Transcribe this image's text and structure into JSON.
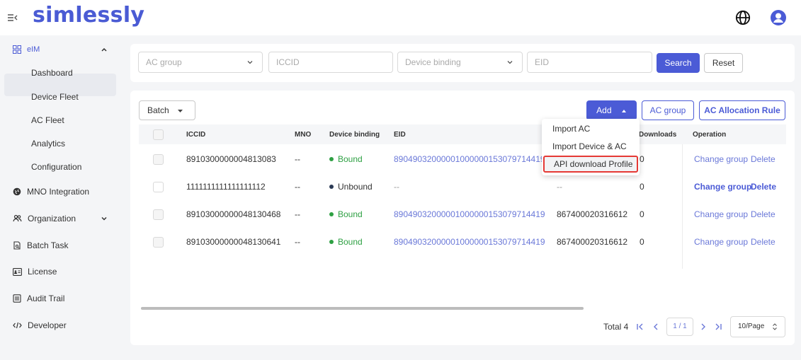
{
  "brand": {
    "logo": "simlessly"
  },
  "sidebar": {
    "group_label": "eIM",
    "sub_items": [
      "Dashboard",
      "Device Fleet",
      "AC Fleet",
      "Analytics",
      "Configuration"
    ],
    "items": [
      "MNO Integration",
      "Organization",
      "Batch Task",
      "License",
      "Audit Trail",
      "Developer"
    ]
  },
  "filters": {
    "ac_group_placeholder": "AC group",
    "iccid_placeholder": "ICCID",
    "device_binding_placeholder": "Device binding",
    "eid_placeholder": "EID",
    "search_label": "Search",
    "reset_label": "Reset"
  },
  "toolbar": {
    "batch_label": "Batch",
    "add_label": "Add",
    "ac_group_label": "AC group",
    "allocation_rule_label": "AC Allocation Rule"
  },
  "dropdown": {
    "items": [
      "Import AC",
      "Import Device & AC",
      "API download Profile"
    ]
  },
  "table": {
    "headers": [
      "ICCID",
      "MNO",
      "Device binding",
      "EID",
      "Downloads",
      "Operation"
    ],
    "rows": [
      {
        "iccid": "8910300000004813083",
        "mno": "--",
        "binding": "Bound",
        "eid": "89049032000001000000153079714419",
        "imei": "",
        "downloads": "0",
        "change": "Change group",
        "delete": "Delete"
      },
      {
        "iccid": "1111111111111111112",
        "mno": "--",
        "binding": "Unbound",
        "eid": "--",
        "imei": "--",
        "downloads": "0",
        "change": "Change group",
        "delete": "Delete"
      },
      {
        "iccid": "89103000000048130468",
        "mno": "--",
        "binding": "Bound",
        "eid": "89049032000001000000153079714419",
        "imei": "867400020316612",
        "downloads": "0",
        "change": "Change group",
        "delete": "Delete"
      },
      {
        "iccid": "89103000000048130641",
        "mno": "--",
        "binding": "Bound",
        "eid": "89049032000001000000153079714419",
        "imei": "867400020316612",
        "downloads": "0",
        "change": "Change group",
        "delete": "Delete"
      }
    ]
  },
  "pagination": {
    "total": "Total 4",
    "page": "1 / 1",
    "page_size": "10/Page"
  },
  "colors": {
    "accent": "#4b5bd6",
    "bound": "#2ea043",
    "highlight": "#e53935"
  }
}
